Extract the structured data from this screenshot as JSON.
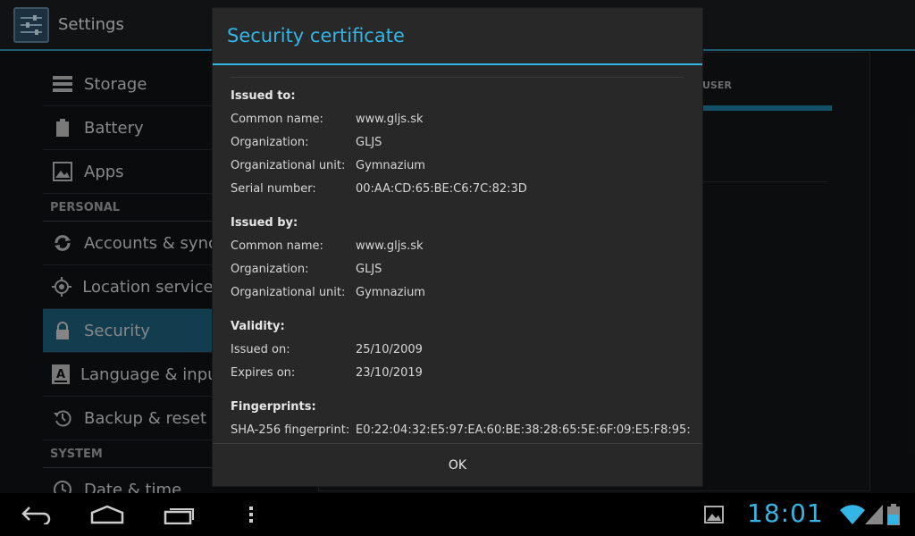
{
  "app": {
    "title": "Settings"
  },
  "settings_list": {
    "items_top": [
      {
        "label": "Storage",
        "icon": "storage-icon"
      },
      {
        "label": "Battery",
        "icon": "battery-icon"
      },
      {
        "label": "Apps",
        "icon": "apps-icon"
      }
    ],
    "personal_header": "PERSONAL",
    "items_personal": [
      {
        "label": "Accounts & sync",
        "icon": "sync-icon"
      },
      {
        "label": "Location services",
        "icon": "location-icon"
      },
      {
        "label": "Security",
        "icon": "lock-icon",
        "selected": true
      },
      {
        "label": "Language & input",
        "icon": "keyboard-letter-icon"
      },
      {
        "label": "Backup & reset",
        "icon": "backup-icon"
      }
    ],
    "system_header": "SYSTEM",
    "items_system": [
      {
        "label": "Date & time",
        "icon": "clock-icon"
      }
    ]
  },
  "right_pane": {
    "tab_label": "USER"
  },
  "dialog": {
    "title": "Security certificate",
    "issued_to": {
      "title": "Issued to:",
      "common_name_label": "Common name:",
      "common_name": "www.gljs.sk",
      "organization_label": "Organization:",
      "organization": "GLJS",
      "unit_label": "Organizational unit:",
      "unit": "Gymnazium",
      "serial_label": "Serial number:",
      "serial": "00:AA:CD:65:BE:C6:7C:82:3D"
    },
    "issued_by": {
      "title": "Issued by:",
      "common_name_label": "Common name:",
      "common_name": "www.gljs.sk",
      "organization_label": "Organization:",
      "organization": "GLJS",
      "unit_label": "Organizational unit:",
      "unit": "Gymnazium"
    },
    "validity": {
      "title": "Validity:",
      "issued_on_label": "Issued on:",
      "issued_on": "25/10/2009",
      "expires_on_label": "Expires on:",
      "expires_on": "23/10/2019"
    },
    "fingerprints": {
      "title": "Fingerprints:",
      "sha256_label": "SHA-256 fingerprint:",
      "sha256": "E0:22:04:32:E5:97:EA:60:BE:38:28:65:5E:6F:09:E5:F8:95:"
    },
    "ok_label": "OK"
  },
  "status": {
    "time": "18:01"
  },
  "colors": {
    "accent": "#33b5e5",
    "selected": "#1c5e7a"
  }
}
